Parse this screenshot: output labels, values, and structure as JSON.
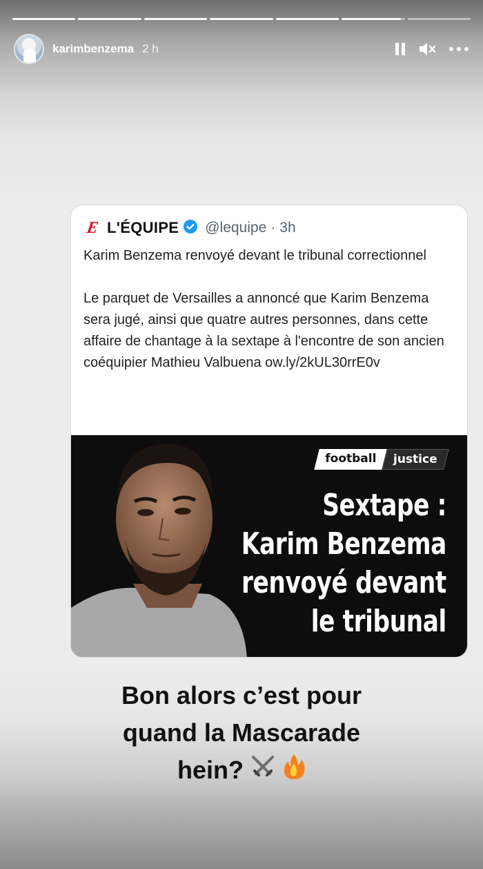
{
  "story": {
    "username": "karimbenzema",
    "time": "2 h",
    "segments": 7,
    "current_segment": 6
  },
  "icons": {
    "pause": "pause-icon",
    "mute": "speaker-muted-icon",
    "more": "more-icon",
    "verified": "verified-badge-icon",
    "swords": "crossed-swords-emoji",
    "fire": "fire-emoji"
  },
  "tweet": {
    "account_name": "L'ÉQUIPE",
    "handle": "@lequipe",
    "separator": "·",
    "age": "3h",
    "text": "Karim Benzema renvoyé devant le tribunal correctionnel\n\nLe parquet de Versailles a annoncé que Karim Benzema sera jugé, ainsi que quatre autres personnes, dans cette affaire de chantage à la sextape à l'encontre de son ancien coéquipier Mathieu Valbuena ow.ly/2kUL30rrE0v",
    "logo_letter": "E"
  },
  "image": {
    "tag_1": "football",
    "tag_2": "justice",
    "headline": [
      "Sextape :",
      "Karim Benzema",
      "renvoyé devant",
      "le tribunal"
    ]
  },
  "caption": {
    "line_1": "Bon alors c’est pour",
    "line_2": "quand la Mascarade",
    "line_3": "hein?"
  },
  "colors": {
    "brand_red": "#e10a1a",
    "verified_blue": "#1d9bf0"
  }
}
